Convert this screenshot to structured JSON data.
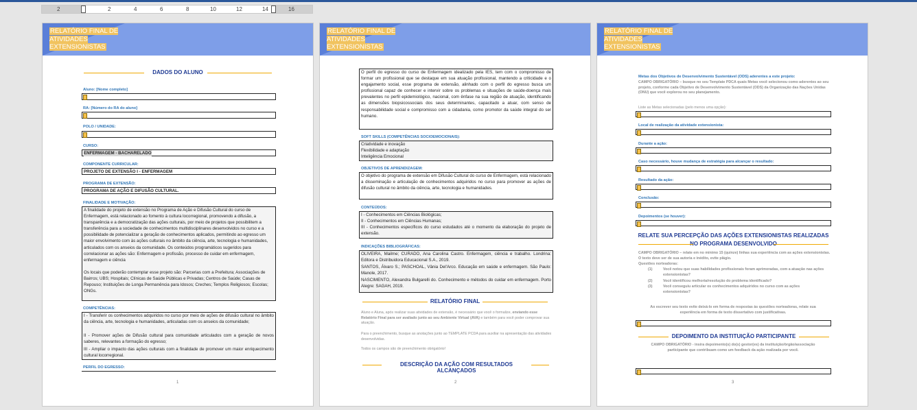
{
  "ruler": {
    "ticks": [
      "2",
      "2",
      "4",
      "6",
      "8",
      "10",
      "12",
      "14",
      "16"
    ]
  },
  "banner_title": "RELATÓRIO FINAL DE ATIVIDADES EXTENSIONISTAS",
  "page1": {
    "section_title": "DADOS DO ALUNO",
    "aluno_label": "Aluno: [Nome completo]",
    "ra_label": "RA: [Número do RA do aluno]",
    "polo_label": "POLO / UNIDADE:",
    "curso_label": "CURSO:",
    "curso_value": "ENFERMAGEM - BACHARELADO",
    "componente_label": "COMPONENTE CURRICULAR:",
    "componente_value": "PROJETO DE EXTENSÃO I - ENFERMAGEM",
    "programa_label": "PROGRAMA DE EXTENSÃO:",
    "programa_value": "PROGRAMA DE AÇÃO E DIFUSÃO CULTURAL.",
    "finalidade_label": "FINALIDADE E MOTIVAÇÃO:",
    "finalidade_text": "A finalidade do projeto de extensão no Programa de Ação e Difusão Cultural do curso de Enfermagem, está relacionado ao fomento à cultura locorregional, promovendo a difusão, a transparência e a democratização das ações culturais, por meio de projetos que possibilitem a transferência para a sociedade de conhecimentos multidisciplinares desenvolvidos no curso e a possibilidade de potencializar a geração de conhecimentos aplicados, permitindo ao egresso um maior envolvimento com às ações culturais no âmbito da ciência, arte, tecnologia e humanidades, articulados com os anseios da comunidade. Os conteúdos programáticos sugeridos para correlacionar as ações são: Enfermagem e profissão, processo de cuidar em enfermagem, enfermagem e ciência",
    "locais_text": "Os locais que poderão contemplar esse projeto são: Parcerias com a Prefeitura; Associações de Bairros; UBS; Hospitais; Clínicas de Saúde Públicas e Privadas; Centros de Saúde; Casas de Repouso; Instituições de Longa Permanência para Idosos; Creches; Templos Religiosos; Escolas; ONGs.",
    "competencias_label": "COMPETÊNCIAS:",
    "comp1": "I - Transferir os conhecimentos adquiridos no curso por meio de ações de difusão cultural no âmbito da ciência, arte, tecnologia e humanidades, articuladas com os anseios da comunidade;",
    "comp2": "II - Promover ações de Difusão cultural para comunidade articulados com a geração de novos saberes, relevantes a formação do egresso;",
    "comp3": "III - Ampliar o impacto das ações culturais com a finalidade de promover um maior enriquecimento cultural locorregional.",
    "perfil_label": "PERFIL DO EGRESSO:",
    "page_number": "1"
  },
  "page2": {
    "perfil_text": "O perfil do egresso do curso de Enfermagem idealizado pela IES, tem com o compromisso de formar um profissional que se destaque em sua atuação profissional, mantendo a criticidade e o engajamento social, esse programa de extensão, alinhado com o perfil do egresso busca um profissional capaz de conhecer e intervir sobre os problemas e situações de saúde-doença mais prevalentes no perfil epidemiológico, nacional, com ênfase na sua região de atuação, identificando as dimensões biopsicossociais dos seus determinantes, capacitado a atuar, com senso de responsabilidade social e compromisso com a cidadania, como promotor da saúde integral do ser humano.",
    "soft_label": "SOFT SKILLS (COMPETÊNCIAS SOCIOEMOCIONAIS):",
    "soft1": "Criatividade e inovação",
    "soft2": "Flexibilidade e adaptação",
    "soft3": "Inteligência Emocional",
    "objetivos_label": "OBJETIVOS DE APRENDIZAGEM:",
    "objetivos_text": "O objetivo do programa de extensão em Difusão Cultural do curso de Enfermagem, está relacionado a disseminação e articulação de conhecimentos adquiridos no curso para promover as ações de difusão cultural no âmbito da ciência, arte, tecnologia e humanidades.",
    "conteudos_label": "CONTEÚDOS:",
    "cont1": "I - Conhecimentos em Ciências Biológicas;",
    "cont2": "II - Conhecimentos em Ciências Humanas;",
    "cont3": "III - Conhecimentos específicos do curso estudados até o momento da elaboração do projeto de extensão.",
    "indicacoes_label": "INDICAÇÕES BIBLIOGRÁFICAS:",
    "ref1": "OLIVEIRA, Mailme; CURADO, Ana Carolina Castro. Enfermagem, ciência e trabalho. Londrina: Editora e Distribuidora Educacional S.A., 2019.",
    "ref2": "SANTOS, Álvaro S.; PASCHOAL, Vânia Del'Arco. Educação em saúde e enfermagem. São Paulo: Manole, 2017.",
    "ref3": "NASCIMENTO, Alexandra Bulgarelli do. Conhecimento e métodos do cuidar em enfermagem. Porto Alegre: SAGAH, 2019.",
    "relatorio_title": "RELATÓRIO FINAL",
    "instr1a": "Aluno e Aluna, após realizar suas atividades de extensão, é necessário que você o formalize, ",
    "instr1b": "enviando esse Relatório Final para ser avaliado junto ao seu Ambiente Virtual (AVA)",
    "instr1c": " e também para você poder comprovar sua atuação.",
    "instr2": "Para o preenchimento, busque as anotações junto ao TEMPLATE PCDA para auxiliar na apresentação das atividades desenvolvidas.",
    "instr3": "Todos os campos são de preenchimento obrigatório!",
    "descricao_title": "DESCRIÇÃO DA AÇÃO COM RESULTADOS ALCANÇADOS",
    "page_number": "2"
  },
  "page3": {
    "metas_title": "Metas dos Objetivos de Desenvolvimento Sustentável (ODS) aderentes a este projeto:",
    "metas_text": "CAMPO OBRIGATÓRIO – busque no seu Template PDCA quais Metas você selecionou como aderentes ao seu projeto, conforme cada Objetivo de Desenvolvimento Sustentável (ODS) da Organização das Nações Unidas (ONU) que você explorou no seu planejamento.",
    "liste_label": "Liste as Metas selecionadas (pelo menos uma opção):",
    "local_label": "Local de realização da atividade extensionista:",
    "durante_label": "Durante a ação:",
    "mudanca_label": "Caso necessário, houve mudança de estratégia para alcançar o resultado:",
    "resultado_label": "Resultado da ação:",
    "conclusao_label": "Conclusão:",
    "depoimentos_label": "Depoimentos (se houver):",
    "relate_title": "RELATE SUA PERCEPÇÃO DAS AÇÕES EXTENSIONISTAS REALIZADAS NO PROGRAMA DESENVOLVIDO",
    "relate_text": "CAMPO OBRIGATÓRIO – relate em no mínimo 15 (quinze) linhas sua experiência com as ações extensionistas. O texto deve ser de sua autoria e inédito, evite plágio.",
    "questoes_label": "Questões norteadoras:",
    "q1_num": "(1)",
    "q1": "Você notou que suas habilidades profissionais foram aprimoradas, com a atuação nas ações extensionistas?",
    "q2_num": "(2)",
    "q2": "Você identificou melhoria/resolução do problema identificado?",
    "q3_num": "(3)",
    "q3": "Você conseguiu articular os conhecimentos adquiridos no curso com as ações extensionistas?",
    "ao_escrever": "Ao escrever seu texto evite deixá-lo em forma de respostas às questões norteadoras, relate sua experiência em forma de texto dissertativo com justificativas.",
    "depoimento_title": "DEPOIMENTO DA INSTITUIÇÃO PARTICIPANTE",
    "depoimento_text": "CAMPO OBRIGATÓRIO - insira depoimento(s) do(s) gestor(es) da instituição/órgão/associação participante que contribuam como um feedback da ação realizada por você.",
    "page_number": "3"
  }
}
